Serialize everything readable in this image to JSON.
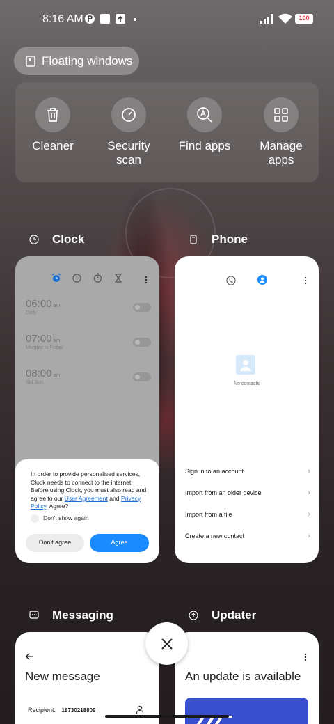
{
  "status_bar": {
    "time": "8:16 AM",
    "battery": "100"
  },
  "floating_windows": {
    "label": "Floating windows"
  },
  "tools": [
    {
      "label": "Cleaner",
      "icon": "trash-icon"
    },
    {
      "label": "Security\nscan",
      "icon": "security-scan-icon"
    },
    {
      "label": "Find apps",
      "icon": "find-apps-icon"
    },
    {
      "label": "Manage\napps",
      "icon": "grid-icon"
    }
  ],
  "apps": {
    "clock": {
      "title": "Clock",
      "alarms": [
        {
          "time": "06:00",
          "ampm": "am",
          "repeat": "Daily"
        },
        {
          "time": "07:00",
          "ampm": "am",
          "repeat": "Monday to Friday"
        },
        {
          "time": "08:00",
          "ampm": "am",
          "repeat": "Sat Sun"
        }
      ],
      "consent": {
        "text_before": "In order to provide personalised services, Clock needs to connect to the internet. Before using Clock, you must also read and agree to our ",
        "link1": "User Agreement",
        "and": " and ",
        "link2": "Privacy Policy",
        "text_after": ". Agree?",
        "dont_show": "Don't show again",
        "disagree": "Don't agree",
        "agree": "Agree"
      }
    },
    "phone": {
      "title": "Phone",
      "empty": "No contacts",
      "actions": [
        "Sign in to an account",
        "Import from an older device",
        "Import from a file",
        "Create a new contact"
      ]
    },
    "messaging": {
      "title": "Messaging",
      "heading": "New message",
      "recipient_label": "Recipient:",
      "recipient_value": "18730218809"
    },
    "updater": {
      "title": "Updater",
      "heading": "An update is available"
    }
  },
  "colors": {
    "accent": "#1a8cff",
    "link": "#1a73d9"
  }
}
